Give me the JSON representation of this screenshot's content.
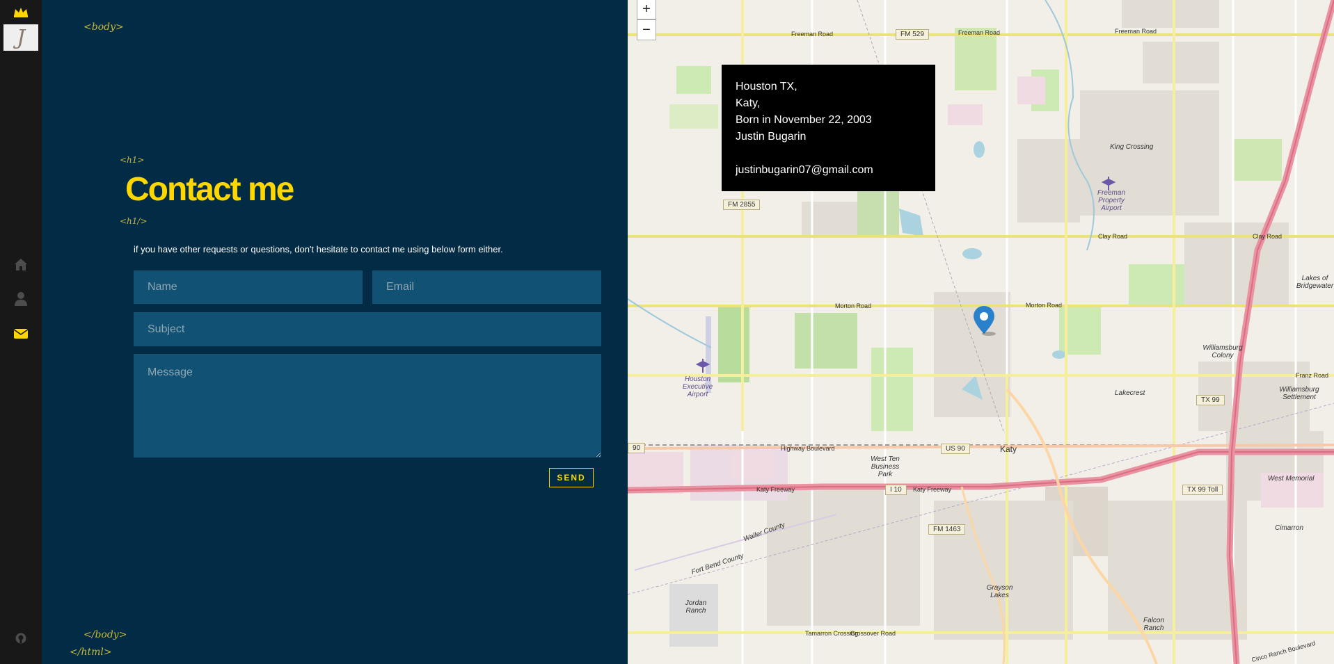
{
  "sidebar": {
    "logo_letter": "J",
    "nav": [
      {
        "name": "home-icon"
      },
      {
        "name": "user-icon"
      },
      {
        "name": "envelope-icon"
      }
    ],
    "accent": "#ffd700"
  },
  "page": {
    "tag_body_open": "<body>",
    "tag_h1_open": "<h1>",
    "title": "Contact me",
    "tag_h1_close": "<h1/>",
    "intro": "if you have other requests or questions, don't hesitate to contact me using below form either.",
    "tag_body_close": "</body>",
    "tag_html_close": "</html>"
  },
  "form": {
    "name_placeholder": "Name",
    "email_placeholder": "Email",
    "subject_placeholder": "Subject",
    "message_placeholder": "Message",
    "send_label": "SEND"
  },
  "map": {
    "zoom_in": "+",
    "zoom_out": "−",
    "info_lines": [
      "Houston TX,",
      "Katy,",
      "Born in November 22, 2003",
      "Justin Bugarin",
      "",
      "justinbugarin07@gmail.com"
    ],
    "labels": {
      "freeman_road_1": "Freeman Road",
      "fm529": "FM 529",
      "freeman_road_2": "Freeman Road",
      "freeman_road_3": "Freeman Road",
      "fm2855": "FM 2855",
      "king_crossing": "King Crossing",
      "freeman_airport": "Freeman Property Airport",
      "clay_road": "Clay Road",
      "morton_road_1": "Morton Road",
      "morton_road_2": "Morton Road",
      "houston_exec": "Houston Executive Airport",
      "williamsburg_colony": "Williamsburg Colony",
      "franz_road": "Franz Road",
      "lakecrest": "Lakecrest",
      "tx99": "TX 99",
      "williamsburg_settlement": "Williamsburg Settlement",
      "us90": "US 90",
      "katy": "Katy",
      "highway_boulevard": "Highway Boulevard",
      "west_ten": "West Ten Business Park",
      "i10": "I 10",
      "katy_freeway_1": "Katy Freeway",
      "katy_freeway_2": "Katy Freeway",
      "tx99_toll": "TX 99 Toll",
      "west_memorial": "West Memorial",
      "fm1463": "FM 1463",
      "cimarron": "Cimarron",
      "jordan_ranch": "Jordan Ranch",
      "grayson_lakes": "Grayson Lakes",
      "falcon_ranch": "Falcon Ranch",
      "tamarron": "Tamarron Crossing",
      "crossover": "Crossover Road",
      "lakes_bridgewater": "Lakes of Bridgewater",
      "route90": "90",
      "fort_bend": "Fort Bend County",
      "waller": "Waller County",
      "cinco_ranch": "Cinco Ranch Boulevard"
    }
  }
}
